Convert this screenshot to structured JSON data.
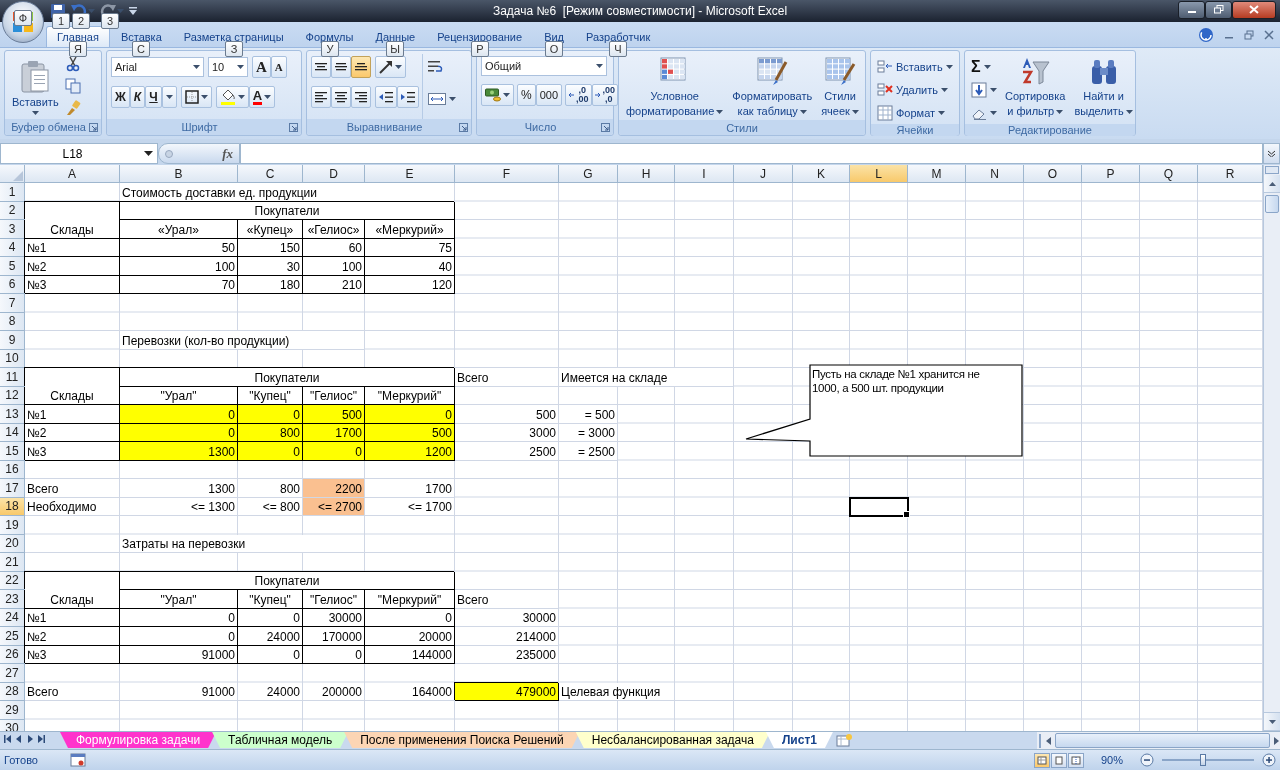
{
  "window": {
    "title": "Задача №6  [Режим совместимости] - Microsoft Excel"
  },
  "office_button": {
    "keytip": "Ф"
  },
  "quick_access": [
    {
      "keytip": "1"
    },
    {
      "keytip": "2"
    },
    {
      "keytip": "3"
    }
  ],
  "tabs": [
    {
      "label": "Главная",
      "selected": true,
      "keytip": "Я"
    },
    {
      "label": "Вставка",
      "selected": false,
      "keytip": "С"
    },
    {
      "label": "Разметка страницы",
      "selected": false,
      "keytip": "З"
    },
    {
      "label": "Формулы",
      "selected": false,
      "keytip": "У"
    },
    {
      "label": "Данные",
      "selected": false,
      "keytip": "Ы"
    },
    {
      "label": "Рецензирование",
      "selected": false,
      "keytip": "Р"
    },
    {
      "label": "Вид",
      "selected": false,
      "keytip": "О"
    },
    {
      "label": "Разработчик",
      "selected": false,
      "keytip": "Ч"
    }
  ],
  "ribbon": [
    {
      "kind": "clipboard",
      "label": "Буфер обмена",
      "dialog_launcher": true,
      "paste": "Вставить"
    },
    {
      "kind": "font",
      "label": "Шрифт",
      "dialog_launcher": true,
      "font": "Arial",
      "size": "10",
      "grow": "A",
      "shrink": "A",
      "bold": "Ж",
      "italic": "К",
      "underline": "Ч",
      "font_color": "A"
    },
    {
      "kind": "alignment",
      "label": "Выравнивание",
      "dialog_launcher": true,
      "vertical_align": [
        {
          "selected": false
        },
        {
          "selected": false
        },
        {
          "selected": true
        }
      ],
      "horizontal_align": [
        {
          "selected": false
        },
        {
          "selected": false
        },
        {
          "selected": false
        }
      ]
    },
    {
      "kind": "number",
      "label": "Число",
      "dialog_launcher": true,
      "format": "Общий",
      "percent": "%",
      "thousands": "000",
      "increase_decimal": [
        ",0",
        ",00"
      ],
      "decrease_decimal": [
        ",00",
        ",0"
      ]
    },
    {
      "kind": "styles",
      "label": "Стили",
      "dialog_launcher": false,
      "buttons": [
        {
          "lines": [
            "Условное",
            "форматирование"
          ]
        },
        {
          "lines": [
            "Форматировать",
            "как таблицу"
          ]
        },
        {
          "lines": [
            "Стили",
            "ячеек"
          ]
        }
      ]
    },
    {
      "kind": "cells",
      "label": "Ячейки",
      "dialog_launcher": false,
      "buttons": [
        "Вставить",
        "Удалить",
        "Формат"
      ]
    },
    {
      "kind": "editing",
      "label": "Редактирование",
      "dialog_launcher": false,
      "autosum": "Σ",
      "buttons": [
        {
          "lines": [
            "Сортировка",
            "и фильтр"
          ]
        },
        {
          "lines": [
            "Найти и",
            "выделить"
          ]
        }
      ]
    }
  ],
  "formula_bar": {
    "name_box": "L18",
    "fx": "fx"
  },
  "sheet": {
    "columns": [
      {
        "label": "A",
        "selected": false
      },
      {
        "label": "B",
        "selected": false
      },
      {
        "label": "C",
        "selected": false
      },
      {
        "label": "D",
        "selected": false
      },
      {
        "label": "E",
        "selected": false
      },
      {
        "label": "F",
        "selected": false
      },
      {
        "label": "G",
        "selected": false
      },
      {
        "label": "H",
        "selected": false
      },
      {
        "label": "I",
        "selected": false
      },
      {
        "label": "J",
        "selected": false
      },
      {
        "label": "K",
        "selected": false
      },
      {
        "label": "L",
        "selected": true
      },
      {
        "label": "M",
        "selected": false
      },
      {
        "label": "N",
        "selected": false
      },
      {
        "label": "O",
        "selected": false
      },
      {
        "label": "P",
        "selected": false
      },
      {
        "label": "Q",
        "selected": false
      },
      {
        "label": "R",
        "selected": false
      }
    ],
    "rows": [
      {
        "label": "1",
        "selected": false
      },
      {
        "label": "2",
        "selected": false
      },
      {
        "label": "3",
        "selected": false
      },
      {
        "label": "4",
        "selected": false
      },
      {
        "label": "5",
        "selected": false
      },
      {
        "label": "6",
        "selected": false
      },
      {
        "label": "7",
        "selected": false
      },
      {
        "label": "8",
        "selected": false
      },
      {
        "label": "9",
        "selected": false
      },
      {
        "label": "10",
        "selected": false
      },
      {
        "label": "11",
        "selected": false
      },
      {
        "label": "12",
        "selected": false
      },
      {
        "label": "13",
        "selected": false
      },
      {
        "label": "14",
        "selected": false
      },
      {
        "label": "15",
        "selected": false
      },
      {
        "label": "16",
        "selected": false
      },
      {
        "label": "17",
        "selected": false
      },
      {
        "label": "18",
        "selected": true
      },
      {
        "label": "19",
        "selected": false
      },
      {
        "label": "20",
        "selected": false
      },
      {
        "label": "21",
        "selected": false
      },
      {
        "label": "22",
        "selected": false
      },
      {
        "label": "23",
        "selected": false
      },
      {
        "label": "24",
        "selected": false
      },
      {
        "label": "25",
        "selected": false
      },
      {
        "label": "26",
        "selected": false
      },
      {
        "label": "27",
        "selected": false
      },
      {
        "label": "28",
        "selected": false
      },
      {
        "label": "29",
        "selected": false
      },
      {
        "label": "30",
        "selected": false
      }
    ],
    "blocks": [
      {
        "kind": "unit_costs",
        "title": "Стоимость доставки ед. продукции",
        "buyers_label": "Покупатели",
        "warehouses_label": "Склады",
        "buyers": [
          "«Урал»",
          "«Купец»",
          "«Гелиос»",
          "«Меркурий»"
        ],
        "rows": [
          {
            "warehouse": "№1",
            "values": [
              {
                "text": "50"
              },
              {
                "text": "150"
              },
              {
                "text": "60"
              },
              {
                "text": "75"
              }
            ]
          },
          {
            "warehouse": "№2",
            "values": [
              {
                "text": "100"
              },
              {
                "text": "30"
              },
              {
                "text": "100"
              },
              {
                "text": "40"
              }
            ]
          },
          {
            "warehouse": "№3",
            "values": [
              {
                "text": "70"
              },
              {
                "text": "180"
              },
              {
                "text": "210"
              },
              {
                "text": "120"
              }
            ]
          }
        ]
      },
      {
        "kind": "shipments",
        "title": "Перевозки (кол-во продукции)",
        "buyers_label": "Покупатели",
        "warehouses_label": "Склады",
        "total_label": "Всего",
        "stock_label": "Имеется на складе",
        "buyers": [
          "\"Урал\"",
          "\"Купец\"",
          "\"Гелиос\"",
          "\"Меркурий\""
        ],
        "rows": [
          {
            "warehouse": "№1",
            "values": [
              {
                "text": "0",
                "color": "#ffff00"
              },
              {
                "text": "0",
                "color": "#ffff00"
              },
              {
                "text": "500",
                "color": "#ffff00"
              },
              {
                "text": "0",
                "color": "#ffff00"
              }
            ],
            "total": "500",
            "stock": "= 500"
          },
          {
            "warehouse": "№2",
            "values": [
              {
                "text": "0",
                "color": "#ffff00"
              },
              {
                "text": "800",
                "color": "#ffff00"
              },
              {
                "text": "1700",
                "color": "#ffff00"
              },
              {
                "text": "500",
                "color": "#ffff00"
              }
            ],
            "total": "3000",
            "stock": "= 3000"
          },
          {
            "warehouse": "№3",
            "values": [
              {
                "text": "1300",
                "color": "#ffff00"
              },
              {
                "text": "0",
                "color": "#ffff00"
              },
              {
                "text": "0",
                "color": "#ffff00"
              },
              {
                "text": "1200",
                "color": "#ffff00"
              }
            ],
            "total": "2500",
            "stock": "= 2500"
          }
        ],
        "totals": {
          "label": "Всего",
          "values": [
            {
              "text": "1300"
            },
            {
              "text": "800"
            },
            {
              "text": "2200",
              "color": "#fac090"
            },
            {
              "text": "1700"
            }
          ]
        },
        "required": {
          "label": "Необходимо",
          "values": [
            {
              "text": "<= 1300"
            },
            {
              "text": "<= 800"
            },
            {
              "text": "<= 2700",
              "color": "#fac090"
            },
            {
              "text": "<= 1700"
            }
          ]
        },
        "callout": "Пусть на складе №1 хранится не 1000, а 500 шт. продукции"
      },
      {
        "kind": "costs",
        "title": "Затраты на перевозки",
        "buyers_label": "Покупатели",
        "warehouses_label": "Склады",
        "total_label": "Всего",
        "buyers": [
          "\"Урал\"",
          "\"Купец\"",
          "\"Гелиос\"",
          "\"Меркурий\""
        ],
        "rows": [
          {
            "warehouse": "№1",
            "values": [
              {
                "text": "0"
              },
              {
                "text": "0"
              },
              {
                "text": "30000"
              },
              {
                "text": "0"
              }
            ],
            "total": "30000"
          },
          {
            "warehouse": "№2",
            "values": [
              {
                "text": "0"
              },
              {
                "text": "24000"
              },
              {
                "text": "170000"
              },
              {
                "text": "20000"
              }
            ],
            "total": "214000"
          },
          {
            "warehouse": "№3",
            "values": [
              {
                "text": "91000"
              },
              {
                "text": "0"
              },
              {
                "text": "0"
              },
              {
                "text": "144000"
              }
            ],
            "total": "235000"
          }
        ],
        "totals": {
          "label": "Всего",
          "values": [
            {
              "text": "91000"
            },
            {
              "text": "24000"
            },
            {
              "text": "200000"
            },
            {
              "text": "164000"
            }
          ],
          "total": {
            "text": "479000",
            "color": "#ffff00"
          },
          "note": "Целевая функция"
        }
      }
    ]
  },
  "sheet_tabs": [
    {
      "label": "Формулировка задачи",
      "selected": false,
      "color": "#ff33cc"
    },
    {
      "label": "Табличная модель",
      "selected": false,
      "color": "#ccffcc"
    },
    {
      "label": "После применения Поиска Решений",
      "selected": false,
      "color": "#fcd5b4"
    },
    {
      "label": "Несбалансированная задача",
      "selected": false,
      "color": "#ffffcc"
    },
    {
      "label": "Лист1",
      "selected": true
    }
  ],
  "status_bar": {
    "status": "Готово",
    "views": [
      {
        "selected": true
      },
      {
        "selected": false
      },
      {
        "selected": false
      }
    ],
    "zoom": "90%",
    "zoom_slider": {
      "level": 0.45
    }
  }
}
